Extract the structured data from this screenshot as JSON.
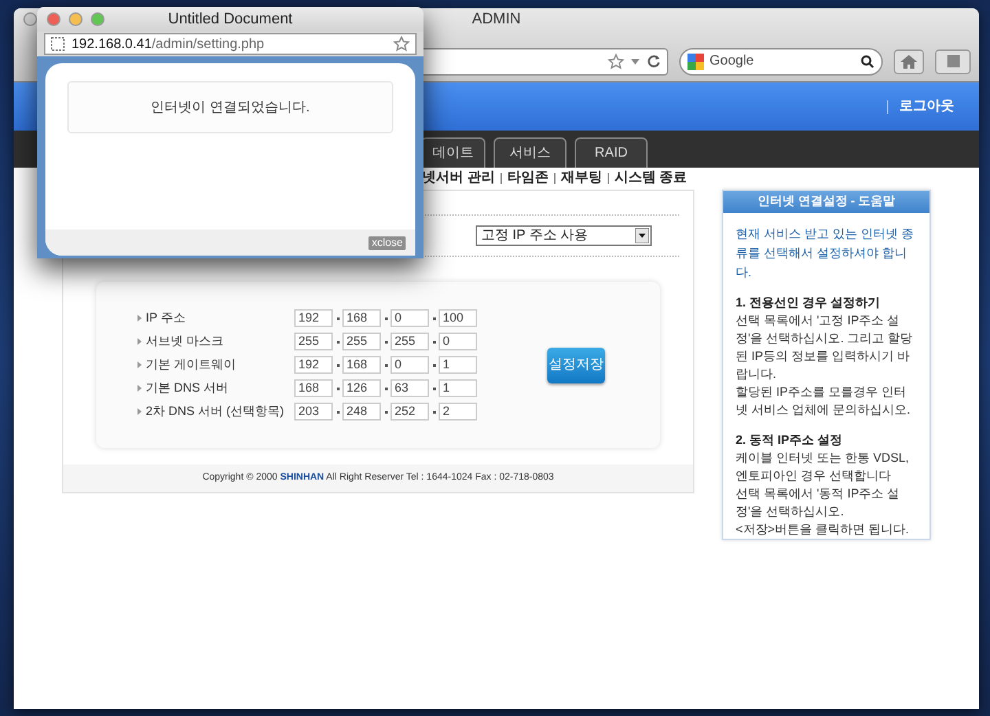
{
  "main_window": {
    "title": "ADMIN",
    "search": {
      "placeholder": "Google"
    },
    "logout": "로그아웃",
    "tabs": [
      {
        "label": "데이트",
        "selected": false
      },
      {
        "label": "서비스",
        "selected": false
      },
      {
        "label": "RAID",
        "selected": false
      }
    ],
    "submenu": [
      "넷서버 관리",
      "타임존",
      "재부팅",
      "시스템 종료"
    ],
    "connection_select": {
      "value": "고정 IP 주소 사용"
    },
    "fields": [
      {
        "label": "IP 주소",
        "octets": [
          "192",
          "168",
          "0",
          "100"
        ]
      },
      {
        "label": "서브넷 마스크",
        "octets": [
          "255",
          "255",
          "255",
          "0"
        ]
      },
      {
        "label": "기본 게이트웨이",
        "octets": [
          "192",
          "168",
          "0",
          "1"
        ]
      },
      {
        "label": "기본 DNS 서버",
        "octets": [
          "168",
          "126",
          "63",
          "1"
        ]
      },
      {
        "label": "2차 DNS 서버 (선택항목)",
        "octets": [
          "203",
          "248",
          "252",
          "2"
        ]
      }
    ],
    "save_button": "설정저장",
    "footer": "Copyright © 2000 **SHINHAN** All Right Reserver Tel : 1644-1024 Fax : 02-718-0803",
    "help": {
      "title": "인터넷 연결설정 - 도움말",
      "intro": "현재 서비스 받고 있는 인터넷 종류를 선택해서 설정하셔야 합니다.",
      "sections": [
        {
          "heading": "1. 전용선인 경우 설정하기",
          "lines": [
            "선택 목록에서 '고정 IP주소 설정'을 선택하십시오. 그리고 할당된 IP등의 정보를 입력하시기 바랍니다.",
            "할당된 IP주소를 모를경우 인터넷 서비스 업체에 문의하십시오."
          ]
        },
        {
          "heading": "2. 동적 IP주소 설정",
          "lines": [
            "케이블 인터넷 또는 한통 VDSL, 엔토피아인 경우 선택합니다",
            "선택 목록에서 '동적 IP주소 설정'을 선택하십시오.",
            "<저장>버튼을 클릭하면 됩니다."
          ]
        }
      ]
    }
  },
  "popup": {
    "title": "Untitled Document",
    "url_host": "192.168.0.41",
    "url_path": "/admin/setting.php",
    "message": "인터넷이 연결되었습니다.",
    "close_button": "xclose"
  }
}
